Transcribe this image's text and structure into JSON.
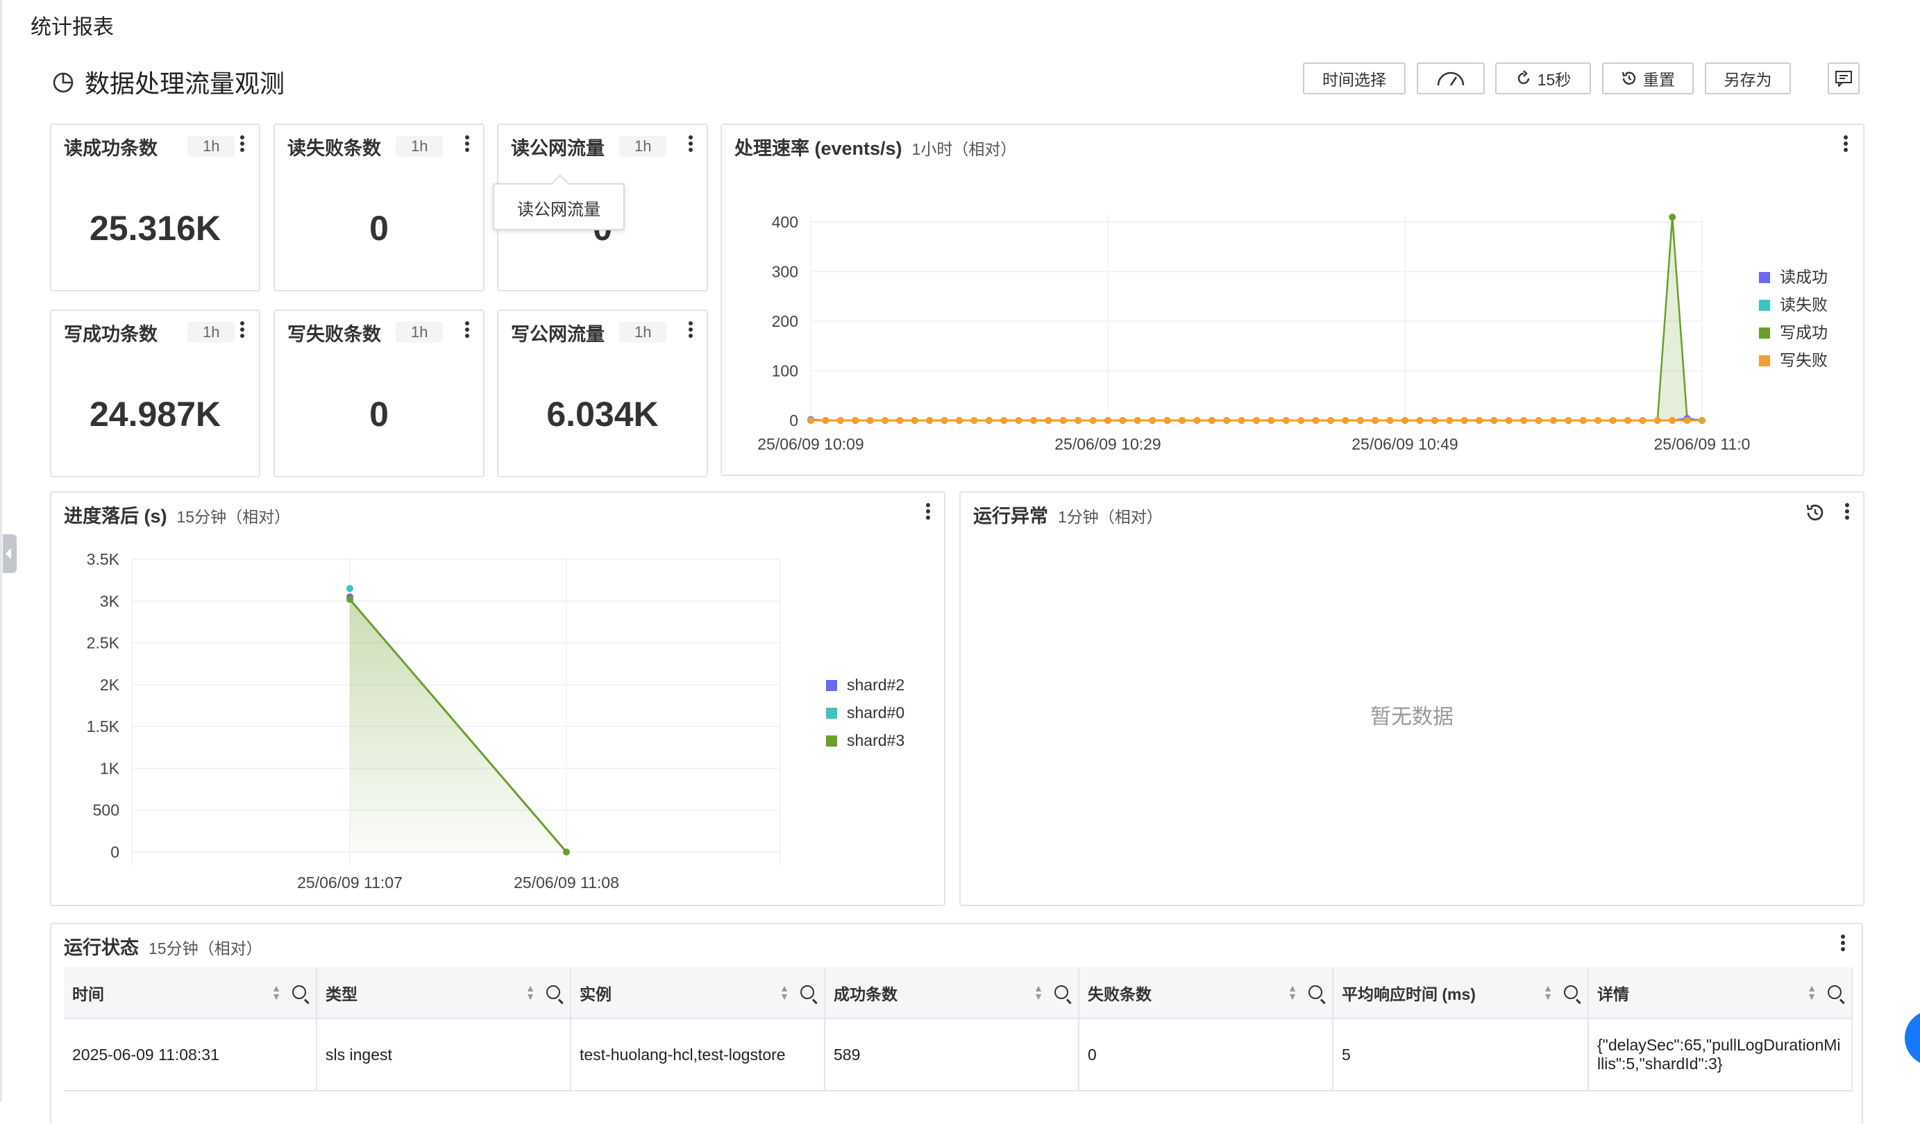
{
  "page": {
    "title": "统计报表",
    "dashboard_title": "数据处理流量观测"
  },
  "toolbar": {
    "time_select": "时间选择",
    "refresh": "15秒",
    "reset": "重置",
    "save_as": "另存为"
  },
  "stats": [
    {
      "title": "读成功条数",
      "range": "1h",
      "value": "25.316K"
    },
    {
      "title": "读失败条数",
      "range": "1h",
      "value": "0"
    },
    {
      "title": "读公网流量",
      "range": "1h",
      "value": "0"
    },
    {
      "title": "写成功条数",
      "range": "1h",
      "value": "24.987K"
    },
    {
      "title": "写失败条数",
      "range": "1h",
      "value": "0"
    },
    {
      "title": "写公网流量",
      "range": "1h",
      "value": "6.034K"
    }
  ],
  "tooltip": {
    "text": "读公网流量"
  },
  "rate_chart": {
    "title": "处理速率 (events/s)",
    "subtitle": "1小时（相对）"
  },
  "lag_chart": {
    "title": "进度落后 (s)",
    "subtitle": "15分钟（相对）"
  },
  "anomaly": {
    "title": "运行异常",
    "subtitle": "1分钟（相对）",
    "empty": "暂无数据"
  },
  "status_table": {
    "title": "运行状态",
    "subtitle": "15分钟（相对）",
    "columns": [
      "时间",
      "类型",
      "实例",
      "成功条数",
      "失败条数",
      "平均响应时间 (ms)",
      "详情"
    ],
    "rows": [
      [
        "2025-06-09 11:08:31",
        "sls ingest",
        "test-huolang-hcl,test-logstore",
        "589",
        "0",
        "5",
        "{\"delaySec\":65,\"pullLogDurationMillis\":5,\"shardId\":3}"
      ]
    ]
  },
  "colors": {
    "read_success": "#6a6af0",
    "read_fail": "#3fc4c0",
    "write_success": "#6b9e2c",
    "write_fail": "#f0a033",
    "shard2": "#6a6af0",
    "shard0": "#3fc4c0",
    "shard3": "#6b9e2c"
  },
  "chart_data": [
    {
      "type": "line",
      "title": "处理速率 (events/s)",
      "subtitle": "1小时（相对）",
      "ylim": [
        0,
        400
      ],
      "yticks": [
        0,
        100,
        200,
        300,
        400
      ],
      "x_ticks": [
        "25/06/09 10:09",
        "25/06/09 10:29",
        "25/06/09 10:49",
        "25/06/09 11:0"
      ],
      "point_count": 61,
      "series": [
        {
          "name": "读成功",
          "values": [
            2,
            0,
            0,
            0,
            0,
            0,
            0,
            0,
            0,
            0,
            0,
            0,
            0,
            0,
            0,
            0,
            0,
            0,
            0,
            0,
            0,
            0,
            0,
            0,
            0,
            0,
            0,
            0,
            0,
            0,
            0,
            0,
            0,
            0,
            0,
            0,
            0,
            0,
            0,
            0,
            0,
            0,
            0,
            0,
            0,
            0,
            0,
            0,
            0,
            0,
            0,
            0,
            0,
            0,
            0,
            0,
            0,
            0,
            0,
            4,
            0
          ]
        },
        {
          "name": "读失败",
          "values": [
            0,
            0,
            0,
            0,
            0,
            0,
            0,
            0,
            0,
            0,
            0,
            0,
            0,
            0,
            0,
            0,
            0,
            0,
            0,
            0,
            0,
            0,
            0,
            0,
            0,
            0,
            0,
            0,
            0,
            0,
            0,
            0,
            0,
            0,
            0,
            0,
            0,
            0,
            0,
            0,
            0,
            0,
            0,
            0,
            0,
            0,
            0,
            0,
            0,
            0,
            0,
            0,
            0,
            0,
            0,
            0,
            0,
            0,
            0,
            0,
            0
          ]
        },
        {
          "name": "写成功",
          "values": [
            0,
            0,
            0,
            0,
            0,
            0,
            0,
            0,
            0,
            0,
            0,
            0,
            0,
            0,
            0,
            0,
            0,
            0,
            0,
            0,
            0,
            0,
            0,
            0,
            0,
            0,
            0,
            0,
            0,
            0,
            0,
            0,
            0,
            0,
            0,
            0,
            0,
            0,
            0,
            0,
            0,
            0,
            0,
            0,
            0,
            0,
            0,
            0,
            0,
            0,
            0,
            0,
            0,
            0,
            0,
            0,
            0,
            0,
            410,
            2,
            0
          ]
        },
        {
          "name": "写失败",
          "values": [
            0,
            0,
            0,
            0,
            0,
            0,
            0,
            0,
            0,
            0,
            0,
            0,
            0,
            0,
            0,
            0,
            0,
            0,
            0,
            0,
            0,
            0,
            0,
            0,
            0,
            0,
            0,
            0,
            0,
            0,
            0,
            0,
            0,
            0,
            0,
            0,
            0,
            0,
            0,
            0,
            0,
            0,
            0,
            0,
            0,
            0,
            0,
            0,
            0,
            0,
            0,
            0,
            0,
            0,
            0,
            0,
            0,
            0,
            0,
            0,
            0
          ]
        }
      ],
      "legend": "right"
    },
    {
      "type": "area",
      "title": "进度落后 (s)",
      "subtitle": "15分钟（相对）",
      "ylim": [
        0,
        3500
      ],
      "yticks": [
        "0",
        "500",
        "1K",
        "1.5K",
        "2K",
        "2.5K",
        "3K",
        "3.5K"
      ],
      "x": [
        "25/06/09 11:07",
        "25/06/09 11:08"
      ],
      "series": [
        {
          "name": "shard#2",
          "values": [
            3050,
            null
          ]
        },
        {
          "name": "shard#0",
          "values": [
            3150,
            null
          ]
        },
        {
          "name": "shard#3",
          "values": [
            3020,
            0
          ]
        }
      ],
      "legend": "right"
    }
  ]
}
